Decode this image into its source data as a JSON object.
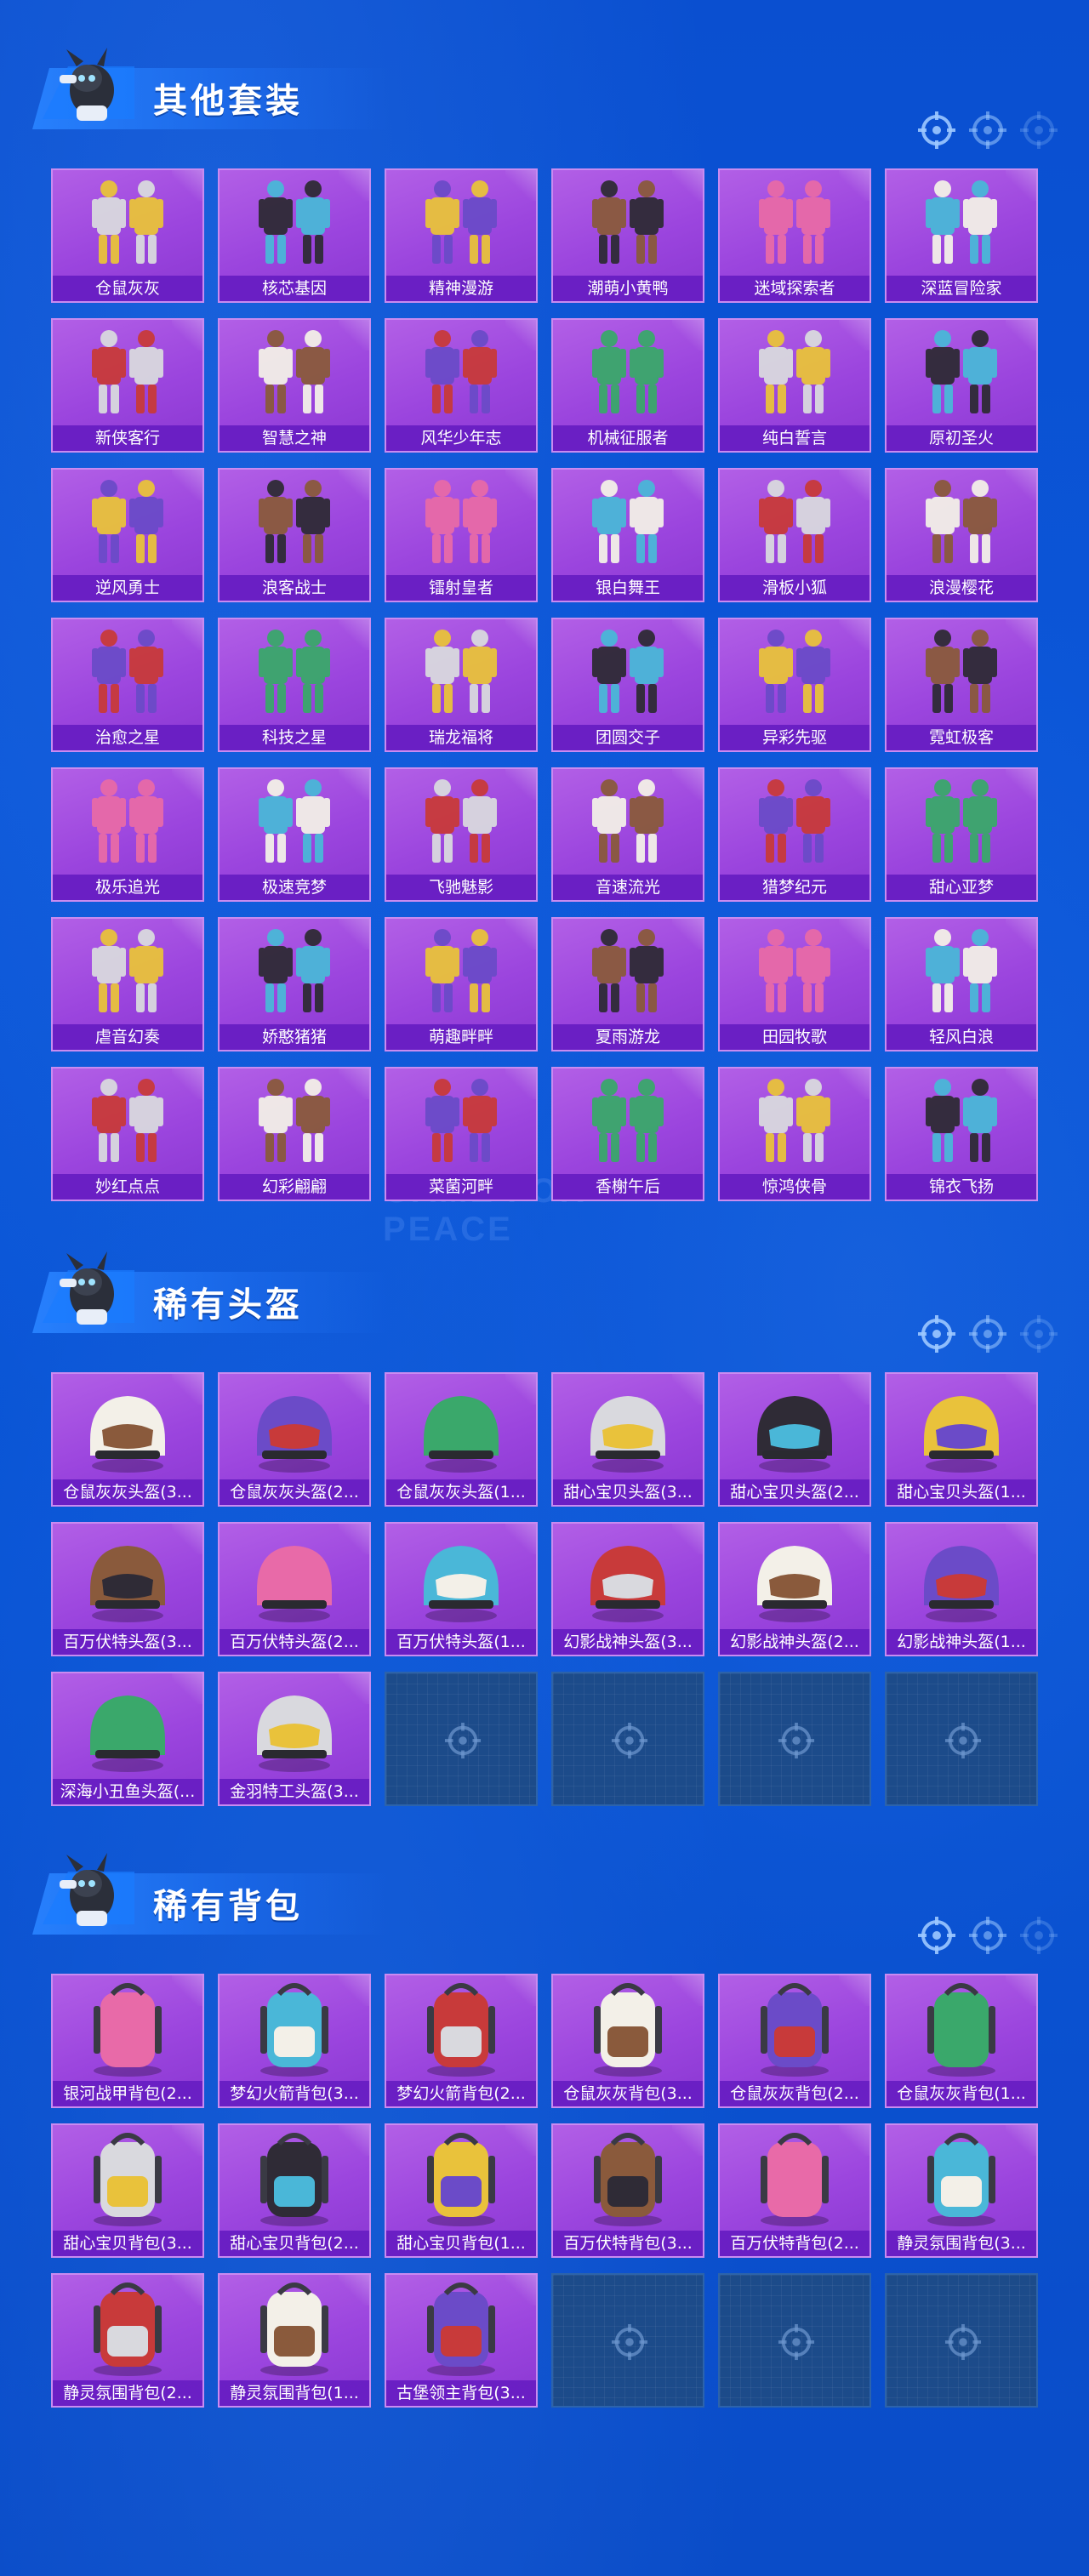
{
  "sections": [
    {
      "title": "其他套装",
      "kind": "outfit",
      "items": [
        "仓鼠灰灰",
        "核芯基因",
        "精神漫游",
        "潮萌小黄鸭",
        "迷域探索者",
        "深蓝冒险家",
        "新侠客行",
        "智慧之神",
        "风华少年志",
        "机械征服者",
        "纯白誓言",
        "原初圣火",
        "逆风勇士",
        "浪客战士",
        "镭射皇者",
        "银白舞王",
        "滑板小狐",
        "浪漫樱花",
        "治愈之星",
        "科技之星",
        "瑞龙福将",
        "团圆交子",
        "异彩先驱",
        "霓虹极客",
        "极乐追光",
        "极速竞梦",
        "飞驰魅影",
        "音速流光",
        "猎梦纪元",
        "甜心亚梦",
        "虐音幻奏",
        "娇憨猪猪",
        "萌趣畔畔",
        "夏雨游龙",
        "田园牧歌",
        "轻风白浪",
        "妙红点点",
        "幻彩翩翩",
        "菜菌河畔",
        "香榭午后",
        "惊鸿侠骨",
        "锦衣飞扬"
      ],
      "empty_slots": 0
    },
    {
      "title": "稀有头盔",
      "kind": "helmet",
      "items": [
        "仓鼠灰灰头盔(3...",
        "仓鼠灰灰头盔(2...",
        "仓鼠灰灰头盔(1...",
        "甜心宝贝头盔(3...",
        "甜心宝贝头盔(2...",
        "甜心宝贝头盔(1...",
        "百万伏特头盔(3...",
        "百万伏特头盔(2...",
        "百万伏特头盔(1...",
        "幻影战神头盔(3...",
        "幻影战神头盔(2...",
        "幻影战神头盔(1...",
        "深海小丑鱼头盔(...",
        "金羽特工头盔(3..."
      ],
      "empty_slots": 4
    },
    {
      "title": "稀有背包",
      "kind": "backpack",
      "items": [
        "银河战甲背包(2...",
        "梦幻火箭背包(3...",
        "梦幻火箭背包(2...",
        "仓鼠灰灰背包(3...",
        "仓鼠灰灰背包(2...",
        "仓鼠灰灰背包(1...",
        "甜心宝贝背包(3...",
        "甜心宝贝背包(2...",
        "甜心宝贝背包(1...",
        "百万伏特背包(3...",
        "百万伏特背包(2...",
        "静灵氛围背包(3...",
        "静灵氛围背包(2...",
        "静灵氛围背包(1...",
        "古堡领主背包(3..."
      ],
      "empty_slots": 3
    }
  ],
  "watermark": "GAME FOR PEACE",
  "icons": {
    "section_mascot": "mascot-icon",
    "section_target": "crosshair-icon",
    "empty_slot": "crosshair-icon"
  },
  "colors": {
    "page_bg": "#0b56d8",
    "card_bg": "#9b45de",
    "card_label_bg": "#6a1fc4",
    "empty_bg": "#1c4b8a"
  }
}
